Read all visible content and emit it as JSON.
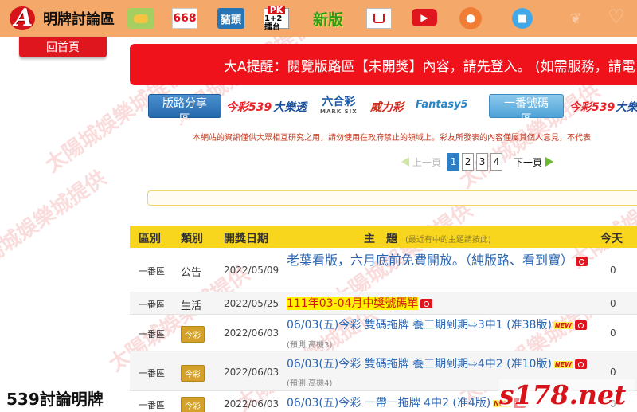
{
  "header": {
    "brand_letter": "A",
    "brand_title": "明牌討論區",
    "icons": {
      "chat": "chat-icon",
      "n668": "668",
      "zhutou": "豬頭",
      "pk_top": "PK",
      "pk_bottom": "1+2擂台",
      "new_version": "新版",
      "cart": "shopping-cart-icon",
      "youtube": "▶",
      "people": "people-icon",
      "lock": "lock-icon"
    },
    "home_button": "回首頁"
  },
  "notice": {
    "text": "大A提醒：閱覽版路區【未開獎】內容，請先登入。 (如需服務，請電"
  },
  "linkbar": {
    "share_button": "版路分享區",
    "code_button": "一番號碼區",
    "lotteries": {
      "jin539": "今彩539",
      "daletou": "大樂透",
      "liuhecai": "六合彩",
      "liuhecai_sub": "MARK SIX",
      "weili": "威力彩",
      "fantasy5": "Fantasy5",
      "jin539_b": "今彩539",
      "daletou_b": "大樂透"
    }
  },
  "disclaimer": "本網站的資訊僅供大眾相互研究之用，請勿使用在政府禁止的領域上。彩友所發表的內容僅屬其個人意見，不代表",
  "pagination": {
    "prev_label": "上一頁",
    "next_label": "下一頁",
    "pages": [
      "1",
      "2",
      "3",
      "4"
    ],
    "current": "1"
  },
  "table": {
    "headers": {
      "area": "區別",
      "type": "類別",
      "date": "開獎日期",
      "title": "主　題",
      "title_hint": "(最近有中的主題請按此)",
      "today": "今天"
    },
    "rows": [
      {
        "area": "一番區",
        "type": "公告",
        "date": "2022/05/09",
        "title": "老葉看版，六月底前免費開放。（純版路、看到寶）",
        "sub": "",
        "today": "0"
      },
      {
        "area": "一番區",
        "type": "生活",
        "date": "2022/05/25",
        "title": "111年03-04月中獎號碼單",
        "sub": "",
        "today": "0"
      },
      {
        "area": "一番區",
        "type": "今彩",
        "date": "2022/06/03",
        "title": "06/03(五)今彩 雙碼拖牌 養三期到期⇨3中1 (准38版)",
        "sub": "(預測,高機3)",
        "today": "0"
      },
      {
        "area": "一番區",
        "type": "今彩",
        "date": "2022/06/03",
        "title": "06/03(五)今彩 雙碼拖牌 養三期到期⇨4中2 (准10版)",
        "sub": "(預測,高機4)",
        "today": "0"
      },
      {
        "area": "一番區",
        "type": "今彩",
        "date": "2022/06/03",
        "title": "06/03(五)今彩 一帶一拖牌 4中2 (准4版)",
        "sub": "",
        "today": "0"
      }
    ],
    "new_tag": "NEW"
  },
  "watermark": "太陽城娛樂城提供",
  "footer": {
    "left_text": "539討論明牌",
    "right_text": "s178.net"
  },
  "colors": {
    "topbar": "#f4a96a",
    "notice": "#f0121a",
    "accent_red": "#e0161e",
    "header_yellow": "#f9d61e",
    "link_blue": "#2a66b3"
  }
}
